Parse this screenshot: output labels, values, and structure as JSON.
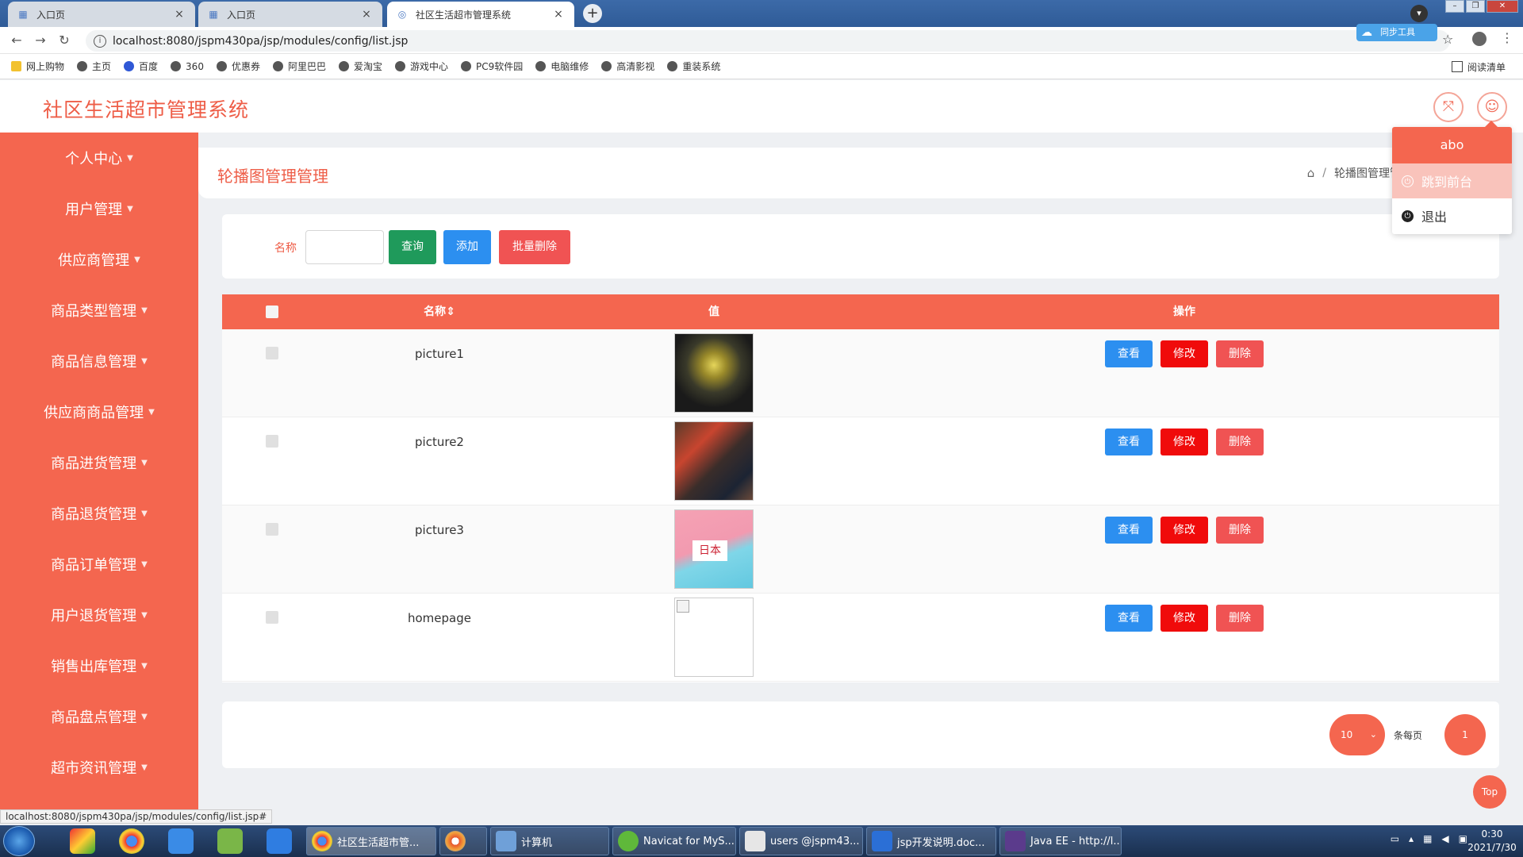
{
  "browser": {
    "tabs": [
      {
        "title": "入口页",
        "active": false
      },
      {
        "title": "入口页",
        "active": false
      },
      {
        "title": "社区生活超市管理系统",
        "active": true
      }
    ],
    "url": "localhost:8080/jspm430pa/jsp/modules/config/list.jsp",
    "cloud_badge": "同步工具",
    "bookmarks": [
      "网上购物",
      "主页",
      "百度",
      "360",
      "优惠券",
      "阿里巴巴",
      "爱淘宝",
      "游戏中心",
      "PC9软件园",
      "电脑维修",
      "高清影视",
      "重装系统"
    ],
    "reading_list": "阅读清单",
    "status_url": "localhost:8080/jspm430pa/jsp/modules/config/list.jsp#"
  },
  "app": {
    "title": "社区生活超市管理系统"
  },
  "user_menu": {
    "username": "abo",
    "items": [
      {
        "label": "跳到前台",
        "icon": "power-icon"
      },
      {
        "label": "退出",
        "icon": "logout-icon"
      }
    ]
  },
  "sidebar": {
    "items": [
      {
        "label": "个人中心"
      },
      {
        "label": "用户管理"
      },
      {
        "label": "供应商管理"
      },
      {
        "label": "商品类型管理"
      },
      {
        "label": "商品信息管理"
      },
      {
        "label": "供应商商品管理"
      },
      {
        "label": "商品进货管理"
      },
      {
        "label": "商品退货管理"
      },
      {
        "label": "商品订单管理"
      },
      {
        "label": "用户退货管理"
      },
      {
        "label": "销售出库管理"
      },
      {
        "label": "商品盘点管理"
      },
      {
        "label": "超市资讯管理"
      }
    ]
  },
  "page": {
    "title": "轮播图管理管理",
    "breadcrumb_sep": "/",
    "breadcrumb_current": "轮播图管理管理"
  },
  "search": {
    "label": "名称",
    "value": "",
    "query_label": "查询",
    "add_label": "添加",
    "batch_delete_label": "批量删除"
  },
  "table": {
    "headers": {
      "name": "名称⇕",
      "value": "值",
      "actions": "操作"
    },
    "rows": [
      {
        "name": "picture1",
        "image": "food-photo-1"
      },
      {
        "name": "picture2",
        "image": "food-photo-2"
      },
      {
        "name": "picture3",
        "image": "japanese-food-banner"
      },
      {
        "name": "homepage",
        "image": "broken-image"
      }
    ],
    "row_actions": {
      "view": "查看",
      "edit": "修改",
      "delete": "删除"
    }
  },
  "pagination": {
    "page_size": "10",
    "page_size_label": "条每页",
    "current_page": "1"
  },
  "back_to_top": "Top",
  "taskbar": {
    "tasks": [
      {
        "label": "社区生活超市管..."
      },
      {
        "label": ""
      },
      {
        "label": "计算机"
      },
      {
        "label": "Navicat for MyS..."
      },
      {
        "label": "users @jspm43..."
      },
      {
        "label": "jsp开发说明.doc..."
      },
      {
        "label": "Java EE - http://l..."
      }
    ],
    "time": "0:30",
    "date": "2021/7/30"
  },
  "colors": {
    "primary": "#f4664f",
    "title": "#ee5d47",
    "query": "#1f9a5b",
    "add": "#2c8ff0",
    "batch_delete": "#f05353",
    "edit": "#f00b0b"
  }
}
